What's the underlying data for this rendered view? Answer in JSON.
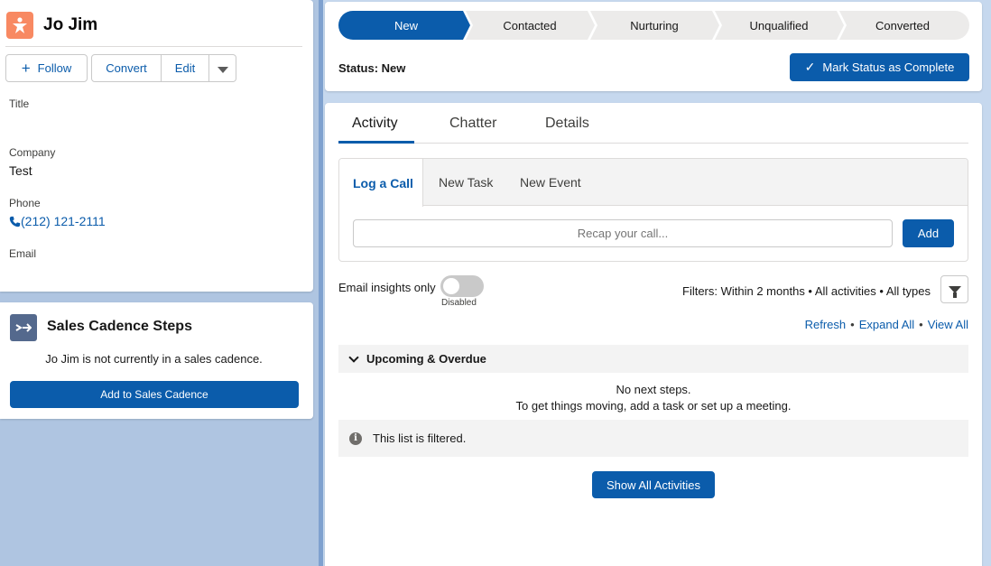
{
  "record": {
    "name": "Jo Jim",
    "follow_label": "Follow",
    "convert_label": "Convert",
    "edit_label": "Edit",
    "fields": {
      "title_label": "Title",
      "title_value": "",
      "company_label": "Company",
      "company_value": "Test",
      "phone_label": "Phone",
      "phone_value": "(212) 121-2111",
      "email_label": "Email",
      "email_value": ""
    }
  },
  "cadence": {
    "title": "Sales Cadence Steps",
    "message": "Jo Jim is not currently in a sales cadence.",
    "button_label": "Add to Sales Cadence"
  },
  "path": {
    "steps": [
      "New",
      "Contacted",
      "Nurturing",
      "Unqualified",
      "Converted"
    ],
    "current_index": 0,
    "status_text": "Status: New",
    "mark_complete_label": "Mark Status as Complete"
  },
  "activity": {
    "tabs": [
      "Activity",
      "Chatter",
      "Details"
    ],
    "composer_tabs": [
      "Log a Call",
      "New Task",
      "New Event"
    ],
    "recap_placeholder": "Recap your call...",
    "add_label": "Add",
    "insights_label": "Email insights only",
    "toggle_state": "Disabled",
    "filters_text": "Filters: Within 2 months • All activities • All types",
    "links": {
      "refresh": "Refresh",
      "expand_all": "Expand All",
      "view_all": "View All",
      "separator": "•"
    },
    "section_title": "Upcoming & Overdue",
    "empty_line1": "No next steps.",
    "empty_line2": "To get things moving, add a task or set up a meeting.",
    "filtered_notice": "This list is filtered.",
    "show_all_label": "Show All Activities"
  },
  "colors": {
    "brand": "#0b5cab",
    "lead_icon": "#f88962",
    "cadence_icon": "#54698d"
  }
}
